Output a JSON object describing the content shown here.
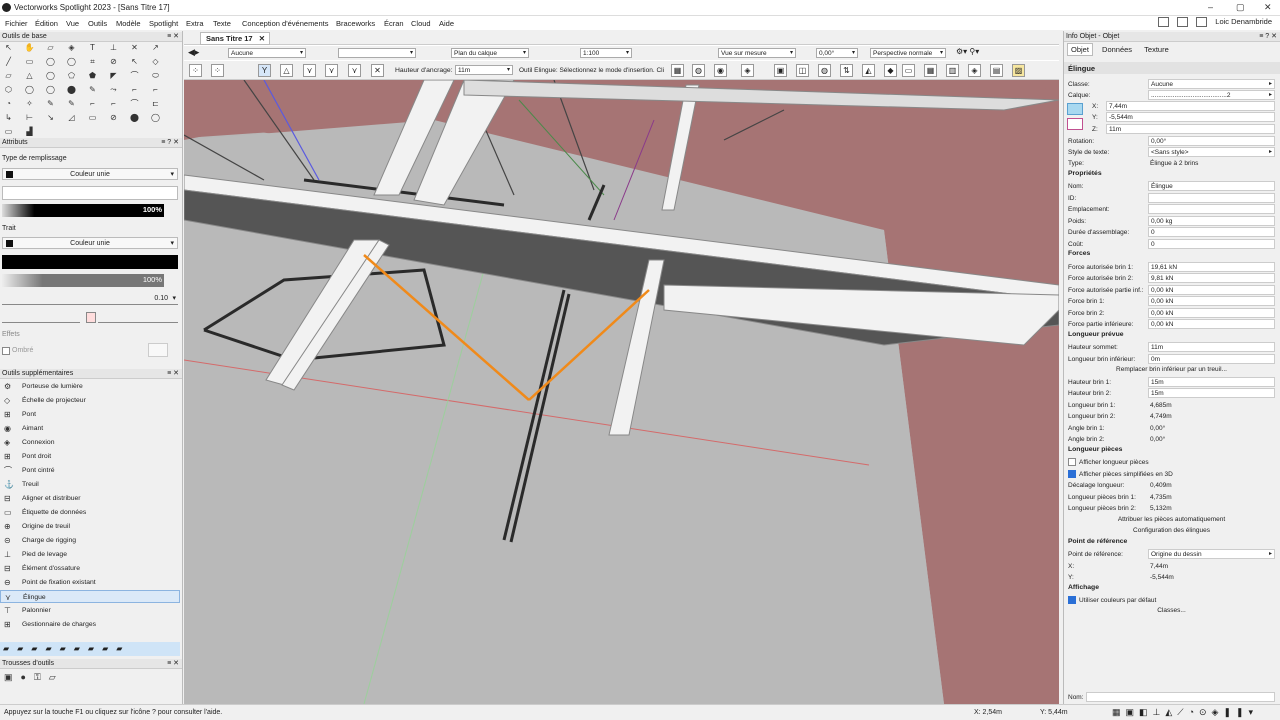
{
  "titlebar": {
    "title": "Vectorworks Spotlight 2023 - [Sans Titre 17]",
    "min": "–",
    "max": "▢",
    "close": "✕"
  },
  "menu": [
    "Fichier",
    "Édition",
    "Vue",
    "Outils",
    "Modèle",
    "Spotlight",
    "Extra",
    "Texte",
    "Conception d'événements",
    "Braceworks",
    "Écran",
    "Cloud",
    "Aide"
  ],
  "user": "Loic Denambride",
  "left": {
    "tools_title": "Outils de base",
    "attributes_title": "Attributs",
    "fill_type_label": "Type de remplissage",
    "fill_value": "Couleur unie",
    "fill_opacity": "100%",
    "stroke_label": "Trait",
    "stroke_value": "Couleur unie",
    "stroke_opacity": "100%",
    "line_weight": "0.10",
    "effects_label": "Effets",
    "shadow_label": "Ombré",
    "suppl_title": "Outils supplémentaires",
    "suppl_items": [
      "Porteuse de lumière",
      "Échelle de projecteur",
      "Pont",
      "Aimant",
      "Connexion",
      "Pont droit",
      "Pont cintré",
      "Treuil",
      "Aligner et distribuer",
      "Étiquette de données",
      "Origine de treuil",
      "Charge de rigging",
      "Pied de levage",
      "Élément d'ossature",
      "Point de fixation existant",
      "Élingue",
      "Palonnier",
      "Gestionnaire de charges"
    ],
    "toolsets_title": "Trousses d'outils"
  },
  "doc": {
    "tab": "Sans Titre 17",
    "close": "✕"
  },
  "viewbar": {
    "class": "Aucune",
    "layer": "Plan du calque",
    "scale": "1:100",
    "view": "Vue sur mesure",
    "angle": "0,00°",
    "render": "Perspective normale"
  },
  "modebar": {
    "anchor_label": "Hauteur d'ancrage:",
    "anchor_value": "11m",
    "hint": "Outil Élingue: Sélectionnez le mode d'insertion. Cli"
  },
  "right": {
    "title": "Info Objet - Objet",
    "tabs": [
      "Objet",
      "Données",
      "Texture"
    ],
    "object_name": "Élingue",
    "classe_label": "Classe:",
    "classe": "Aucune",
    "calque_label": "Calque:",
    "calque": "..........................................2",
    "x_label": "X:",
    "x": "7,44m",
    "y_label": "Y:",
    "y": "-5,544m",
    "z_label": "Z:",
    "z": "11m",
    "rotation_label": "Rotation:",
    "rotation": "0,00°",
    "textstyle_label": "Style de texte:",
    "textstyle": "<Sans style>",
    "type_label": "Type:",
    "type": "Élingue à 2 brins",
    "props_title": "Propriétés",
    "nom_label": "Nom:",
    "nom": "Élingue",
    "id_label": "ID:",
    "id": "",
    "emplacement_label": "Emplacement:",
    "emplacement": "",
    "poids_label": "Poids:",
    "poids": "0,00 kg",
    "duree_label": "Durée d'assemblage:",
    "duree": "0",
    "cout_label": "Coût:",
    "cout": "0",
    "forces_title": "Forces",
    "f1_label": "Force autorisée brin 1:",
    "f1": "19,61 kN",
    "f2_label": "Force autorisée brin 2:",
    "f2": "9,81 kN",
    "f3_label": "Force autorisée partie inf.:",
    "f3": "0,00 kN",
    "fb1_label": "Force brin 1:",
    "fb1": "0,00 kN",
    "fb2_label": "Force brin 2:",
    "fb2": "0,00 kN",
    "fpi_label": "Force partie inférieure:",
    "fpi": "0,00 kN",
    "longprev_title": "Longueur prévue",
    "hs_label": "Hauteur sommet:",
    "hs": "11m",
    "lbi_label": "Longueur brin inférieur:",
    "lbi": "0m",
    "replace_btn": "Remplacer brin inférieur par un treuil...",
    "hb1_label": "Hauteur brin 1:",
    "hb1": "15m",
    "hb2_label": "Hauteur brin 2:",
    "hb2": "15m",
    "lb1_label": "Longueur brin 1:",
    "lb1": "4,685m",
    "lb2_label": "Longueur brin 2:",
    "lb2": "4,749m",
    "ab1_label": "Angle brin 1:",
    "ab1": "0,00°",
    "ab2_label": "Angle brin 2:",
    "ab2": "0,00°",
    "lp_title": "Longueur pièces",
    "show_lengths": "Afficher longueur pièces",
    "show_simplified": "Afficher pièces simplifiées en 3D",
    "offset_label": "Décalage longueur:",
    "offset": "0,409m",
    "lpb1_label": "Longueur pièces brin 1:",
    "lpb1": "4,735m",
    "lpb2_label": "Longueur pièces brin 2:",
    "lpb2": "5,132m",
    "auto_btn": "Attribuer les pièces automatiquement",
    "config_btn": "Configuration des élingues",
    "ref_title": "Point de référence",
    "ref_label": "Point de référence:",
    "ref": "Origine du dessin",
    "rx_label": "X:",
    "rx": "7,44m",
    "ry_label": "Y:",
    "ry": "-5,544m",
    "aff_title": "Affichage",
    "default_colors": "Utiliser couleurs par défaut",
    "classes_btn": "Classes...",
    "nom_bottom": "Nom:"
  },
  "status": {
    "hint": "Appuyez sur la touche F1 ou cliquez sur l'icône ? pour consulter l'aide.",
    "x": "X:  2,54m",
    "y": "Y:  5,44m"
  }
}
